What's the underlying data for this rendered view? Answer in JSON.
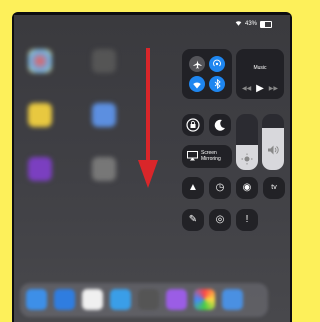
{
  "status_bar": {
    "battery_text": "43%",
    "battery_level": 0.43
  },
  "control_center": {
    "connectivity": {
      "airplane": {
        "icon": "airplane-icon",
        "on": false
      },
      "airdrop": {
        "icon": "airdrop-icon",
        "on": true
      },
      "wifi": {
        "icon": "wifi-icon",
        "on": true
      },
      "bluetooth": {
        "icon": "bluetooth-icon",
        "on": true
      },
      "accent": "#1e86f0"
    },
    "music": {
      "title": "Music"
    },
    "rotation_lock": {
      "icon": "rotation-lock-icon"
    },
    "do_not_disturb": {
      "icon": "moon-icon"
    },
    "screen_mirroring": {
      "label_line1": "Screen",
      "label_line2": "Mirroring"
    },
    "brightness": {
      "level": 0.45,
      "icon": "sun-icon"
    },
    "volume": {
      "level": 0.75,
      "icon": "speaker-icon"
    },
    "bottom_row1": [
      {
        "name": "flashlight",
        "icon": "flashlight-icon",
        "glyph": "▲"
      },
      {
        "name": "timer",
        "icon": "timer-icon",
        "glyph": "◷"
      },
      {
        "name": "camera",
        "icon": "camera-icon",
        "glyph": "◉"
      },
      {
        "name": "apple-tv",
        "icon": "apple-tv-icon",
        "glyph": "tv"
      }
    ],
    "bottom_row2": [
      {
        "name": "notes",
        "icon": "notes-icon",
        "glyph": "✎"
      },
      {
        "name": "screen-recording",
        "icon": "screen-recording-icon",
        "glyph": "◎"
      },
      {
        "name": "info",
        "icon": "info-icon",
        "glyph": "!"
      }
    ]
  },
  "overlay_arrow": {
    "color": "#d9262a",
    "icon": "down-arrow-icon"
  }
}
